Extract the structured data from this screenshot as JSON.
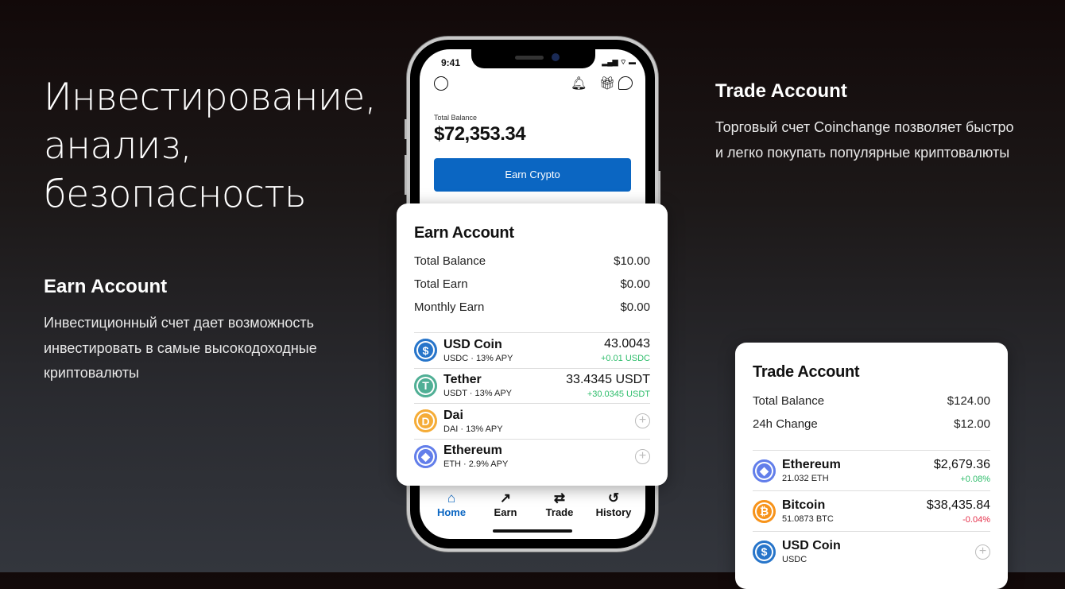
{
  "hero": {
    "line1": "Инвестирование,",
    "line2": "анализ,",
    "line3": "безопасность"
  },
  "earn_section": {
    "title": "Earn Account",
    "text": "Инвестиционный счет дает возможность инвестировать в самые высокодоходные криптовалюты"
  },
  "trade_section": {
    "title": "Trade Account",
    "text": "Торговый счет Coinchange позволяет быстро и легко покупать популярные криптовалюты"
  },
  "phone": {
    "time": "9:41",
    "total_balance_label": "Total Balance",
    "total_balance": "$72,353.34",
    "earn_button": "Earn Crypto",
    "nav": [
      {
        "label": "Home",
        "icon": "home-icon",
        "active": true
      },
      {
        "label": "Earn",
        "icon": "trend-up-icon"
      },
      {
        "label": "Trade",
        "icon": "swap-icon"
      },
      {
        "label": "History",
        "icon": "history-icon"
      }
    ]
  },
  "earn_card": {
    "title": "Earn Account",
    "rows": [
      {
        "label": "Total Balance",
        "value": "$10.00"
      },
      {
        "label": "Total Earn",
        "value": "$0.00"
      },
      {
        "label": "Monthly Earn",
        "value": "$0.00"
      }
    ],
    "coins": [
      {
        "name": "USD Coin",
        "sub": "USDC · 13% APY",
        "value": "43.0043",
        "change": "+0.01 USDC",
        "color": "#2775ca",
        "glyph": "$"
      },
      {
        "name": "Tether",
        "sub": "USDT · 13% APY",
        "value": "33.4345 USDT",
        "change": "+30.0345 USDT",
        "color": "#50af95",
        "glyph": "T"
      },
      {
        "name": "Dai",
        "sub": "DAI · 13% APY",
        "color": "#f5ac37",
        "glyph": "D"
      },
      {
        "name": "Ethereum",
        "sub": "ETH · 2.9% APY",
        "color": "#627eea",
        "glyph": "◆"
      }
    ]
  },
  "trade_card": {
    "title": "Trade Account",
    "rows": [
      {
        "label": "Total Balance",
        "value": "$124.00"
      },
      {
        "label": "24h Change",
        "value": "$12.00"
      }
    ],
    "coins": [
      {
        "name": "Ethereum",
        "sub": "21.032 ETH",
        "value": "$2,679.36",
        "change": "+0.08%",
        "color": "#627eea",
        "glyph": "◆"
      },
      {
        "name": "Bitcoin",
        "sub": "51.0873  BTC",
        "value": "$38,435.84",
        "change": "-0.04%",
        "color": "#f7931a",
        "glyph": "₿"
      },
      {
        "name": "USD Coin",
        "sub": "USDC",
        "color": "#2775ca",
        "glyph": "$"
      }
    ]
  },
  "colors": {
    "accent": "#0b66c2",
    "positive": "#2ebd6b",
    "negative": "#e5304a"
  }
}
